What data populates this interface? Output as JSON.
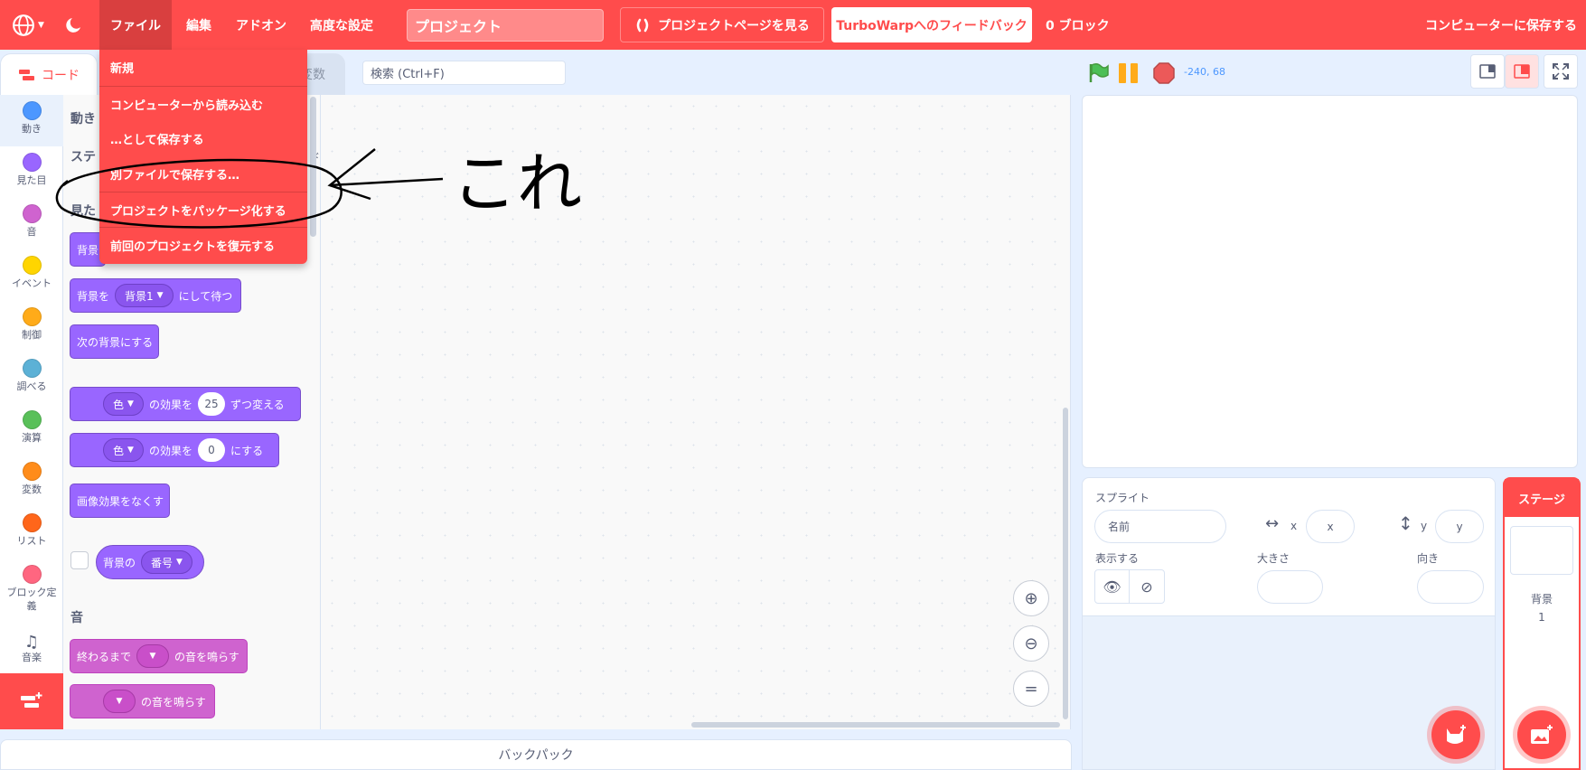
{
  "menubar": {
    "file": "ファイル",
    "edit": "編集",
    "addons": "アドオン",
    "advanced": "高度な設定",
    "project_title": "プロジェクト",
    "see_project": "プロジェクトページを見る",
    "feedback": "TurboWarpへのフィードバック",
    "block_count": "0 ブロック",
    "save": "コンピューターに保存する"
  },
  "file_menu": {
    "items": [
      "新規",
      "コンピューターから読み込む",
      "…として保存する",
      "別ファイルで保存する…",
      "プロジェクトをパッケージ化する",
      "前回のプロジェクトを復元する"
    ]
  },
  "annotation": {
    "text": "これ"
  },
  "tabs": {
    "code": "コード",
    "variables_partial": "変数"
  },
  "search": {
    "placeholder": "検索 (Ctrl+F)"
  },
  "categories": [
    {
      "label": "動き",
      "color": "#4c97ff"
    },
    {
      "label": "見た目",
      "color": "#9966ff"
    },
    {
      "label": "音",
      "color": "#cf63cf"
    },
    {
      "label": "イベント",
      "color": "#ffd500"
    },
    {
      "label": "制御",
      "color": "#ffab19"
    },
    {
      "label": "調べる",
      "color": "#5cb1d6"
    },
    {
      "label": "演算",
      "color": "#59c059"
    },
    {
      "label": "変数",
      "color": "#ff8c1a"
    },
    {
      "label": "リスト",
      "color": "#ff661a"
    },
    {
      "label": "ブロック定義",
      "color": "#ff6680"
    },
    {
      "label": "音楽",
      "color": ""
    }
  ],
  "palette": {
    "section_motion": "動き",
    "stage_note": "ステ",
    "stage_note_end": "ド",
    "section_looks": "見た",
    "block_backdrop_partial": "背景",
    "block_switch_wait": {
      "prefix": "背景を",
      "menu": "背景1",
      "suffix": "にして待つ"
    },
    "block_next_backdrop": "次の背景にする",
    "block_change_effect": {
      "menu": "色",
      "mid": "の効果を",
      "value": "25",
      "suffix": "ずつ変える"
    },
    "block_set_effect": {
      "menu": "色",
      "mid": "の効果を",
      "value": "0",
      "suffix": "にする"
    },
    "block_clear_effects": "画像効果をなくす",
    "block_backdrop_number": {
      "prefix": "背景の",
      "menu": "番号"
    },
    "section_sound": "音",
    "block_play_until_done": {
      "prefix": "終わるまで",
      "suffix": "の音を鳴らす"
    },
    "block_start_sound": {
      "suffix": "の音を鳴らす"
    }
  },
  "stage_header": {
    "coords": "-240, 68"
  },
  "sprite_info": {
    "sprite_label": "スプライト",
    "name_placeholder": "名前",
    "x_label": "x",
    "x_placeholder": "x",
    "y_label": "y",
    "y_placeholder": "y",
    "show_label": "表示する",
    "size_label": "大きさ",
    "direction_label": "向き"
  },
  "stage_selector": {
    "title": "ステージ",
    "backdrops_label": "背景",
    "backdrops_count": "1"
  },
  "backpack": {
    "label": "バックパック"
  }
}
